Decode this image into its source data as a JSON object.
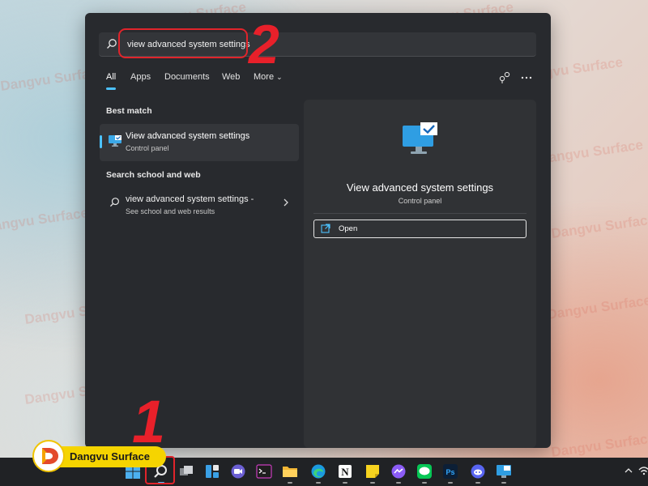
{
  "watermarks": [
    "Dangvu Surface"
  ],
  "search": {
    "value": "view advanced system settings",
    "placeholder": ""
  },
  "annotations": {
    "step1": "1",
    "step2": "2"
  },
  "tabs": [
    {
      "label": "All",
      "active": true
    },
    {
      "label": "Apps"
    },
    {
      "label": "Documents"
    },
    {
      "label": "Web"
    },
    {
      "label": "More"
    }
  ],
  "left": {
    "best_match_title": "Best match",
    "best_match": {
      "title": "View advanced system settings",
      "subtitle": "Control panel",
      "icon": "monitor-check-icon"
    },
    "web_section_title": "Search school and web",
    "web_item": {
      "title": "view advanced system settings -",
      "subtitle": "See school and web results",
      "icon": "search-icon"
    }
  },
  "detail": {
    "title": "View advanced system settings",
    "subtitle": "Control panel",
    "open_label": "Open"
  },
  "taskbar": {
    "icons": [
      "windows-start-icon",
      "search-icon",
      "task-view-icon",
      "widgets-icon",
      "teams-chat-icon",
      "terminal-icon",
      "file-explorer-icon",
      "edge-icon",
      "notion-icon",
      "sticky-notes-icon",
      "messenger-icon",
      "line-icon",
      "photoshop-icon",
      "discord-icon",
      "remote-desktop-icon"
    ],
    "tray": [
      "chevron-up-icon",
      "wifi-icon"
    ]
  },
  "brand": {
    "name": "Dangvu Surface"
  },
  "colors": {
    "accent": "#4cc2ff",
    "panel": "#282a2e",
    "annotation_red": "#e0242b",
    "brand_yellow": "#f5d400"
  }
}
